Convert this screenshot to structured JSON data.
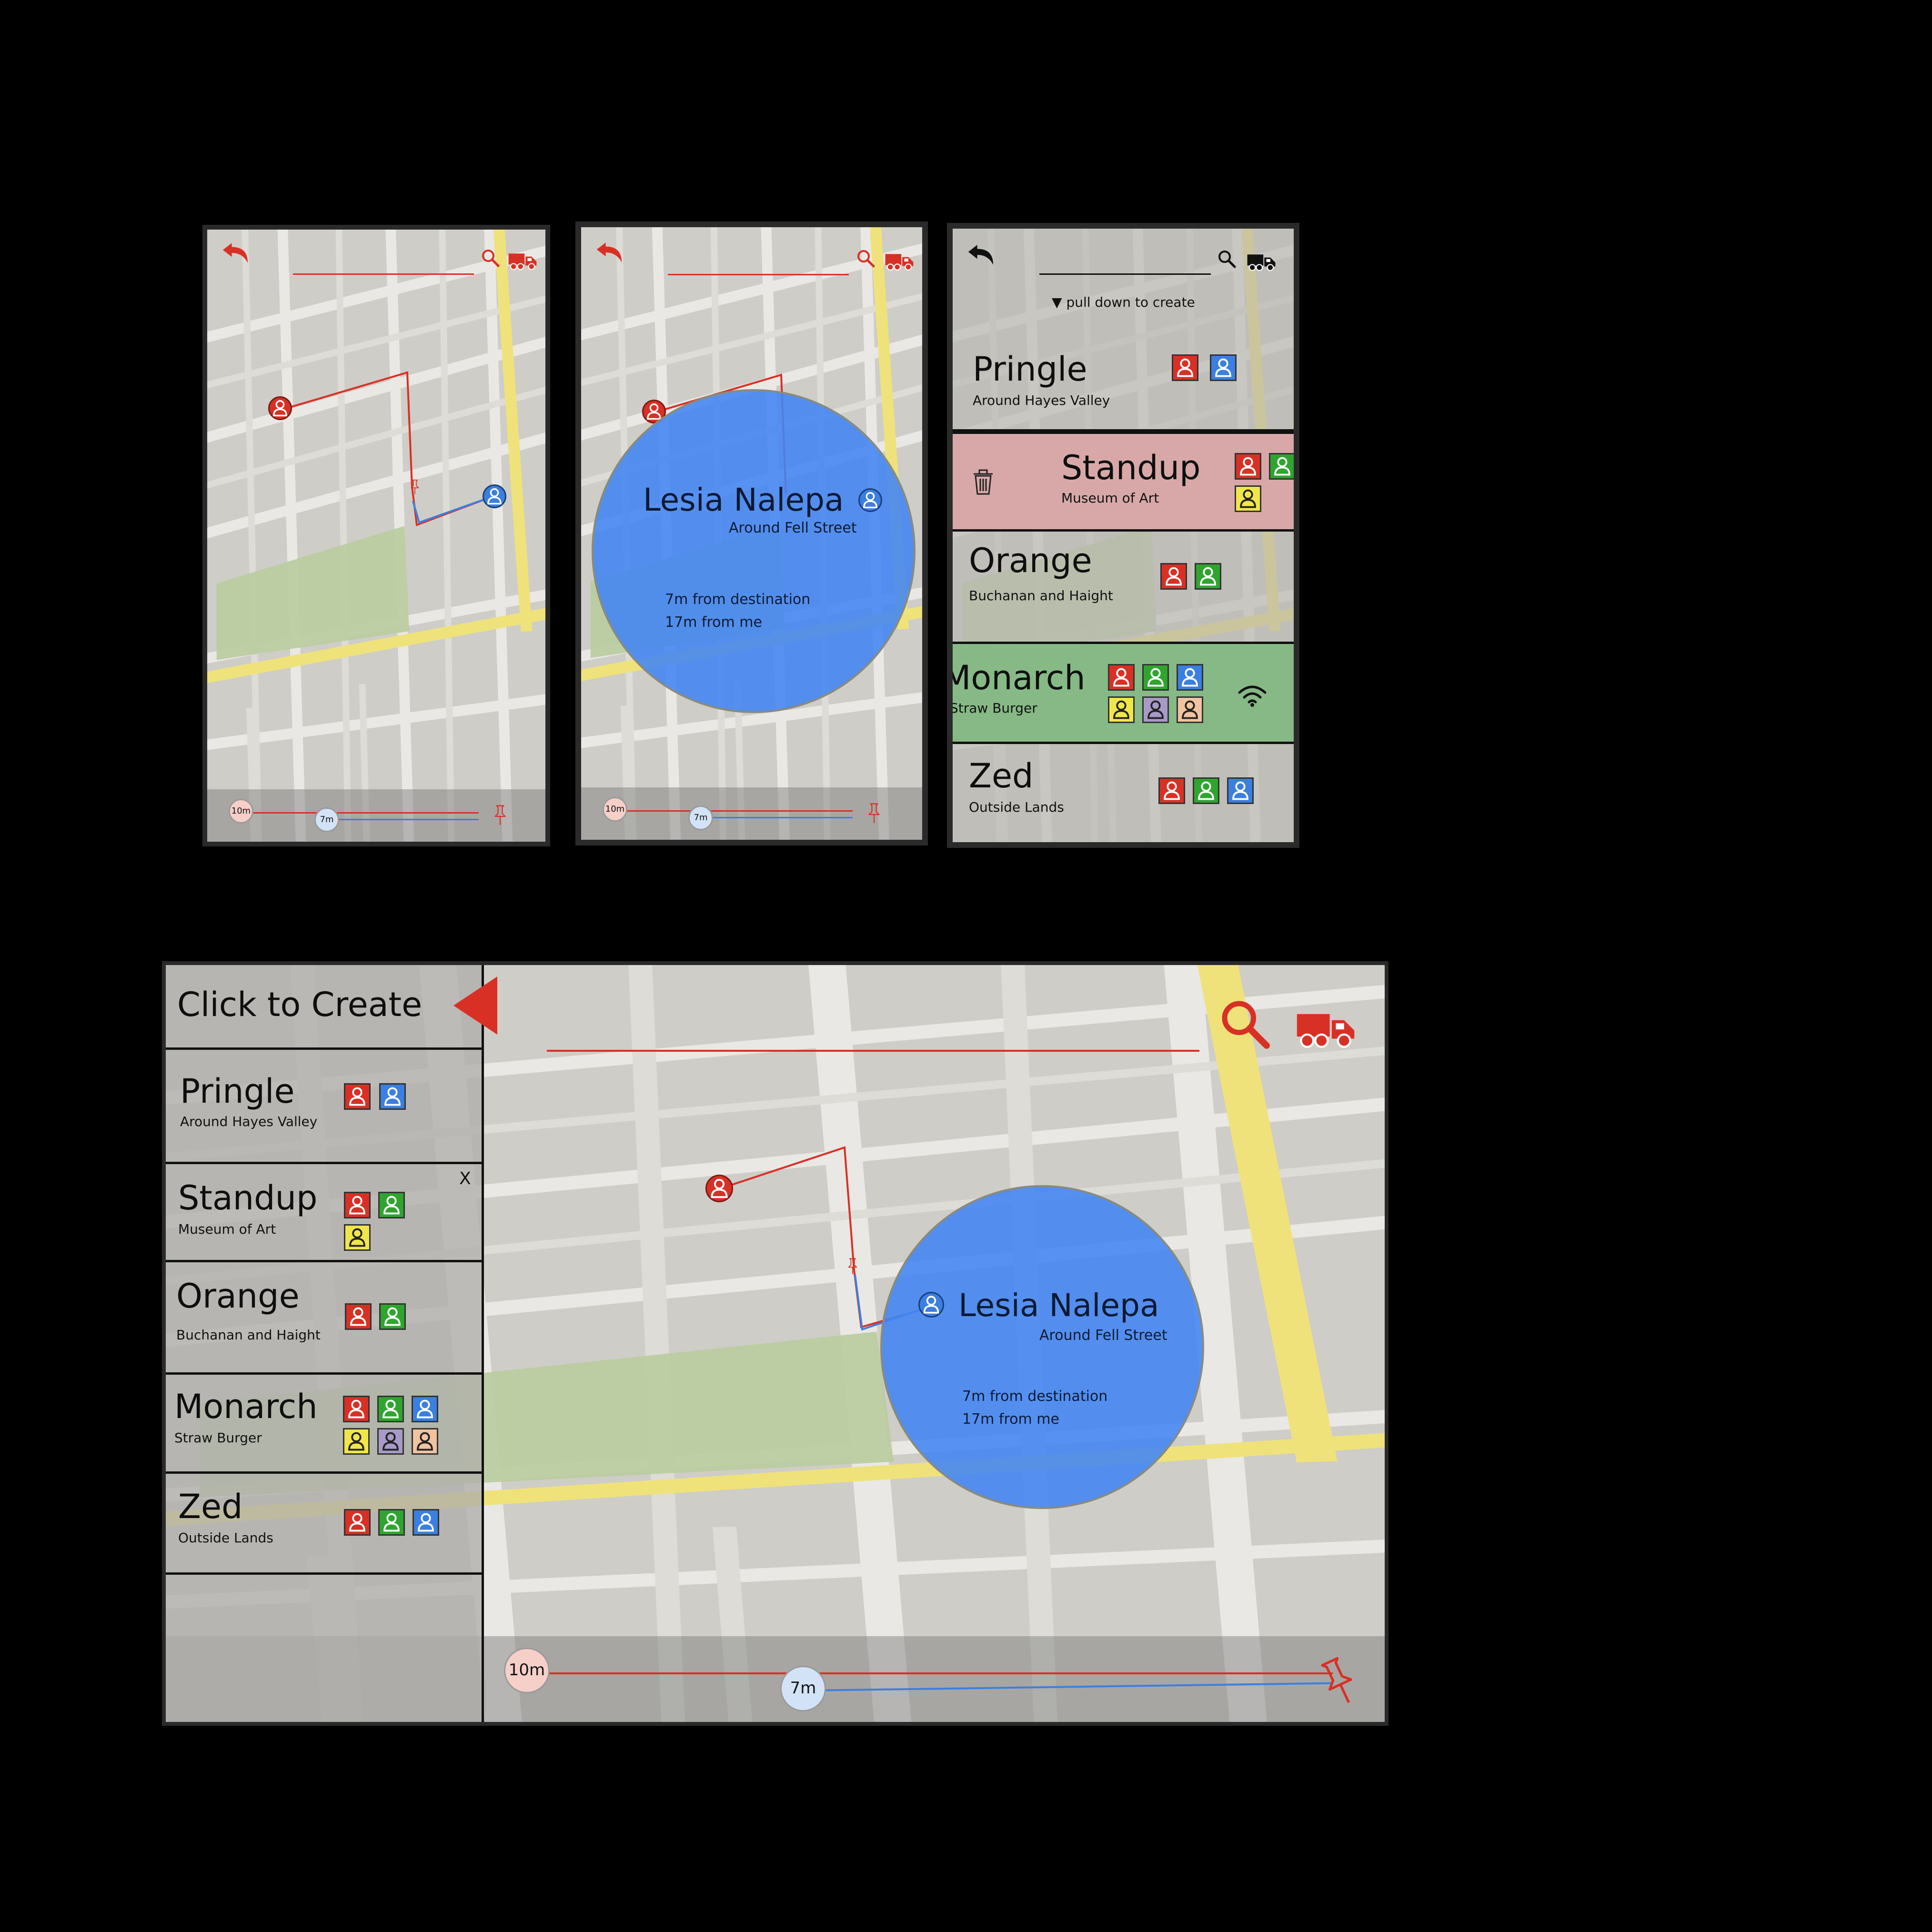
{
  "colors": {
    "accent_red": "#d93025",
    "accent_blue": "#3b7fe0",
    "map_bg": "#cfcdc7",
    "map_street": "#e9e8e4",
    "map_highway": "#efe27a",
    "map_park": "#b9cc9f",
    "row_delete_bg": "#d8a8a8",
    "row_active_bg": "#86b985",
    "list_bg": "#b7b6b1",
    "avatar_red": "#d93025",
    "avatar_green": "#2fa52f",
    "avatar_blue": "#3b7fe0",
    "avatar_yellow": "#f0e64a",
    "avatar_purple": "#a79ac8",
    "avatar_peach": "#f1c3a0"
  },
  "screen1": {
    "back_icon": "undo-arrow-icon",
    "search_icon": "magnifier-icon",
    "truck_icon": "truck-icon",
    "badge_destination": "10m",
    "badge_me": "7m",
    "pin_icon": "pushpin-icon"
  },
  "screen2": {
    "person_name": "Lesia Nalepa",
    "person_location": "Around Fell Street",
    "dist_destination": "7m from destination",
    "dist_me": "17m from me",
    "badge_destination": "10m",
    "badge_me": "7m"
  },
  "screen3": {
    "pull_hint": "pull down to create",
    "trash_icon": "trash-icon",
    "wifi_icon": "wifi-icon",
    "groups": [
      {
        "name": "Pringle",
        "place": "Around Hayes Valley",
        "members": [
          "red",
          "blue"
        ]
      },
      {
        "name": "Standup",
        "place": "Museum of Art",
        "members": [
          "red",
          "green",
          "yellow"
        ],
        "state": "delete"
      },
      {
        "name": "Orange",
        "place": "Buchanan and Haight",
        "members": [
          "red",
          "green"
        ]
      },
      {
        "name": "Monarch",
        "place": "Straw Burger",
        "members": [
          "red",
          "green",
          "blue",
          "yellow",
          "purple",
          "peach"
        ],
        "state": "active"
      },
      {
        "name": "Zed",
        "place": "Outside Lands",
        "members": [
          "red",
          "green",
          "blue"
        ]
      }
    ]
  },
  "tablet": {
    "create_label": "Click to Create",
    "close_label": "X",
    "groups": [
      {
        "name": "Pringle",
        "place": "Around Hayes Valley",
        "members": [
          "red",
          "blue"
        ]
      },
      {
        "name": "Standup",
        "place": "Museum of Art",
        "members": [
          "red",
          "green",
          "yellow"
        ]
      },
      {
        "name": "Orange",
        "place": "Buchanan and Haight",
        "members": [
          "red",
          "green"
        ]
      },
      {
        "name": "Monarch",
        "place": "Straw Burger",
        "members": [
          "red",
          "green",
          "blue",
          "yellow",
          "purple",
          "peach"
        ]
      },
      {
        "name": "Zed",
        "place": "Outside Lands",
        "members": [
          "red",
          "green",
          "blue"
        ]
      }
    ],
    "person_name": "Lesia Nalepa",
    "person_location": "Around Fell Street",
    "dist_destination": "7m from destination",
    "dist_me": "17m from me",
    "badge_destination": "10m",
    "badge_me": "7m"
  }
}
